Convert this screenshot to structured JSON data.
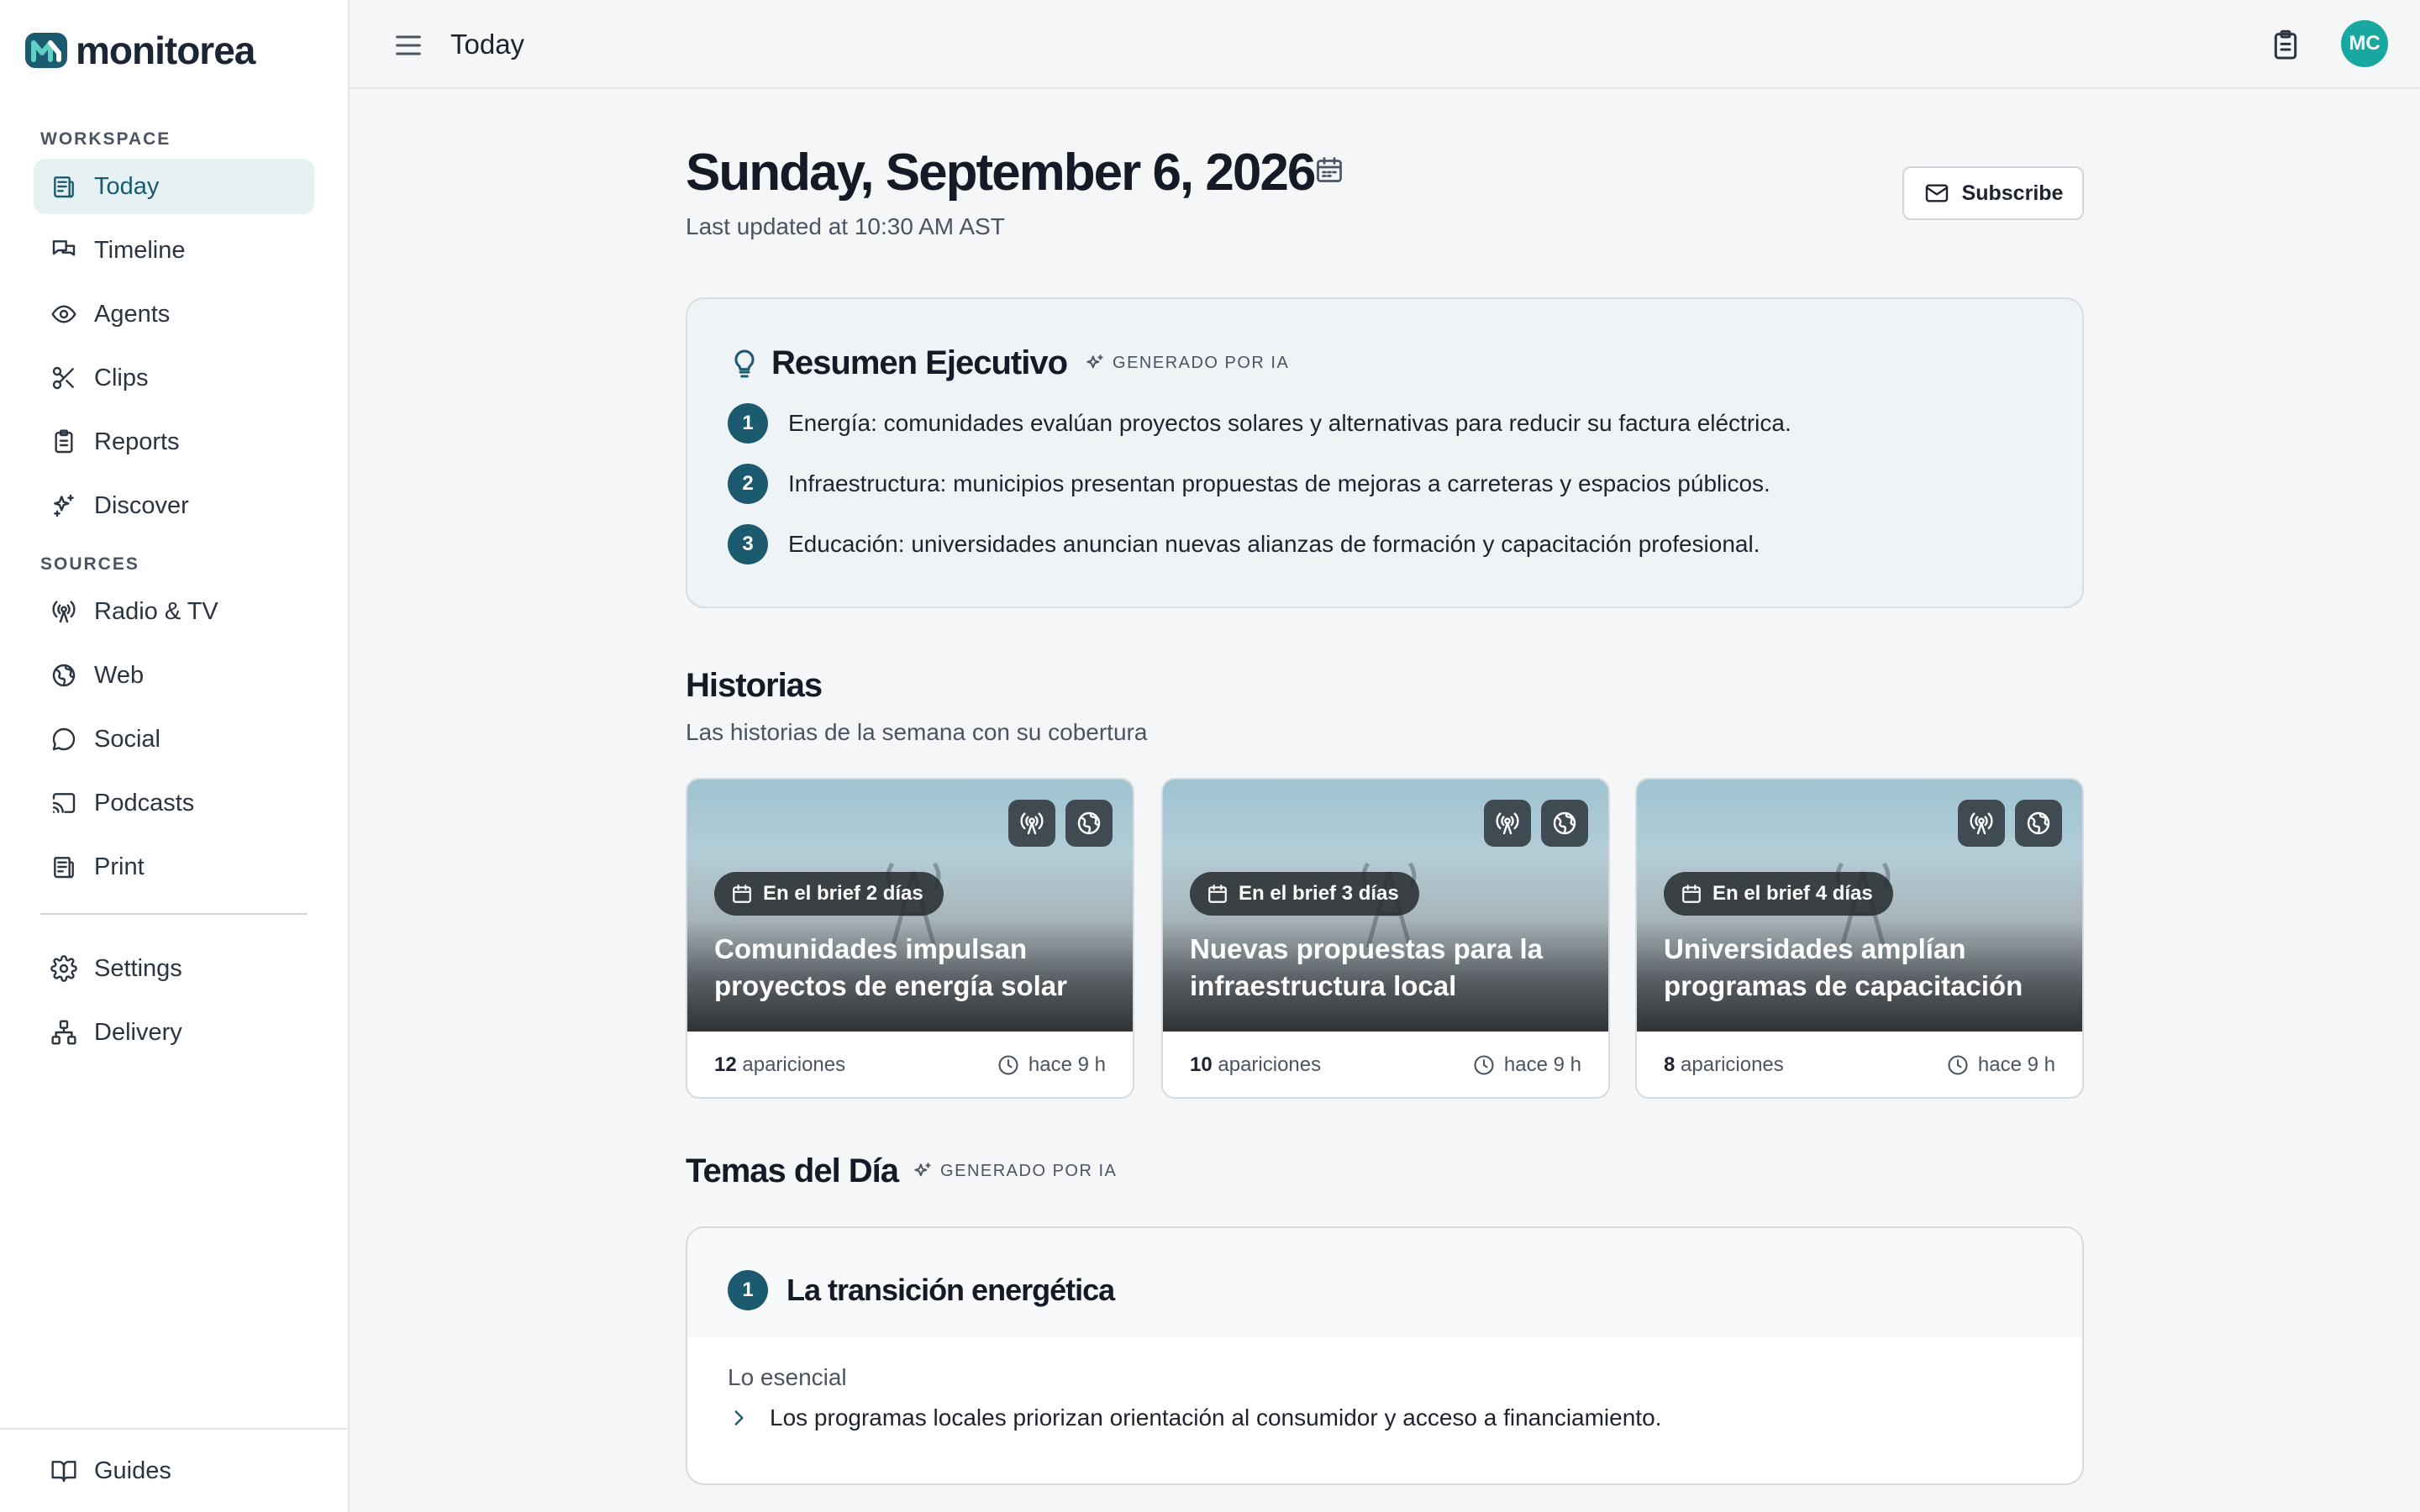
{
  "app": {
    "name": "monitorea"
  },
  "sidebar": {
    "workspace_label": "WORKSPACE",
    "sources_label": "SOURCES",
    "workspace_items": [
      {
        "label": "Today",
        "icon": "newspaper-icon",
        "active": true
      },
      {
        "label": "Timeline",
        "icon": "messages-icon"
      },
      {
        "label": "Agents",
        "icon": "eye-icon"
      },
      {
        "label": "Clips",
        "icon": "scissors-icon"
      },
      {
        "label": "Reports",
        "icon": "clipboard-icon"
      },
      {
        "label": "Discover",
        "icon": "sparkles-icon"
      }
    ],
    "source_items": [
      {
        "label": "Radio & TV",
        "icon": "broadcast-icon"
      },
      {
        "label": "Web",
        "icon": "globe-icon"
      },
      {
        "label": "Social",
        "icon": "chat-bubble-icon"
      },
      {
        "label": "Podcasts",
        "icon": "cast-icon"
      },
      {
        "label": "Print",
        "icon": "newspaper-icon"
      }
    ],
    "settings_items": [
      {
        "label": "Settings",
        "icon": "gear-icon"
      },
      {
        "label": "Delivery",
        "icon": "network-icon"
      }
    ],
    "footer_item": {
      "label": "Guides",
      "icon": "book-icon"
    }
  },
  "topbar": {
    "title": "Today",
    "avatar_initials": "MC",
    "avatar_color": "#17a9a0"
  },
  "header": {
    "date": "Sunday, September 6, 2026",
    "updated": "Last updated at 10:30 AM AST",
    "subscribe_label": "Subscribe"
  },
  "summary": {
    "title": "Resumen Ejecutivo",
    "ai_tag": "GENERADO POR IA",
    "items": [
      {
        "num": "1",
        "text": "Energía: comunidades evalúan proyectos solares y alternativas para reducir su factura eléctrica."
      },
      {
        "num": "2",
        "text": "Infraestructura: municipios presentan propuestas de mejoras a carreteras y espacios públicos."
      },
      {
        "num": "3",
        "text": "Educación: universidades anuncian nuevas alianzas de formación y capacitación profesional."
      }
    ]
  },
  "stories": {
    "title": "Historias",
    "subtitle": "Las historias de la semana con su cobertura",
    "items": [
      {
        "brief": "En el brief 2 días",
        "title": "Comunidades impulsan proyectos de energía solar",
        "count": "12",
        "count_label": "apariciones",
        "time": "hace 9 h"
      },
      {
        "brief": "En el brief 3 días",
        "title": "Nuevas propuestas para la infraestructura local",
        "count": "10",
        "count_label": "apariciones",
        "time": "hace 9 h"
      },
      {
        "brief": "En el brief 4 días",
        "title": "Universidades amplían programas de capacitación",
        "count": "8",
        "count_label": "apariciones",
        "time": "hace 9 h"
      }
    ]
  },
  "topics": {
    "title": "Temas del Día",
    "ai_tag": "GENERADO POR IA",
    "items": [
      {
        "num": "1",
        "title": "La transición energética",
        "essentials_label": "Lo esencial",
        "essentials": [
          "Los programas locales priorizan orientación al consumidor y acceso a financiamiento."
        ]
      }
    ]
  },
  "colors": {
    "accent": "#1c5a70",
    "active_bg": "#e6f1f4"
  }
}
